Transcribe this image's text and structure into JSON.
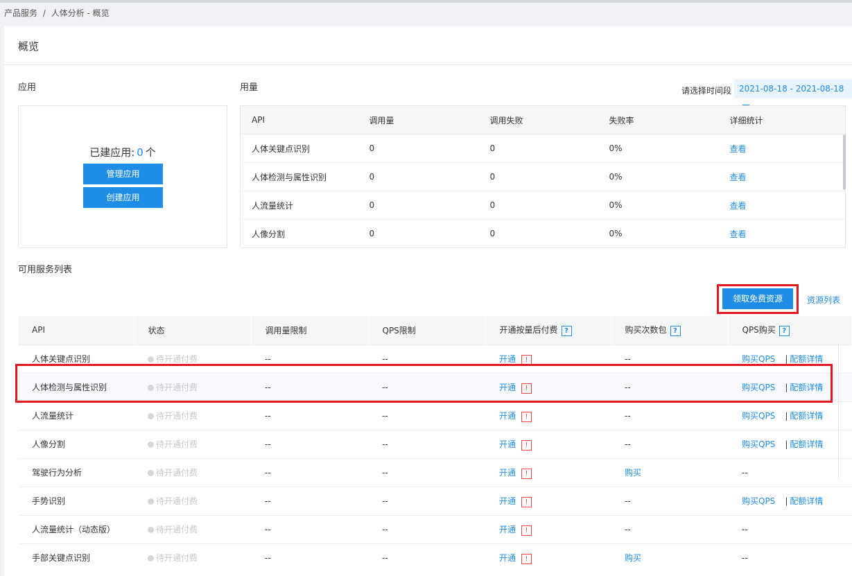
{
  "breadcrumb": {
    "root": "产品服务",
    "sep": "/",
    "current": "人体分析 - 概览"
  },
  "page_title": "概览",
  "app_section": {
    "label": "应用",
    "count_prefix": "已建应用:",
    "count": "0",
    "count_suffix": "个",
    "manage_button": "管理应用",
    "create_button": "创建应用"
  },
  "usage_section": {
    "label": "用量",
    "date_label": "请选择时间段",
    "date_range": "2021-08-18 - 2021-08-18",
    "columns": [
      "API",
      "调用量",
      "调用失败",
      "失败率",
      "详细统计"
    ],
    "rows": [
      {
        "api": "人体关键点识别",
        "calls": "0",
        "fails": "0",
        "rate": "0%",
        "detail": "查看"
      },
      {
        "api": "人体检测与属性识别",
        "calls": "0",
        "fails": "0",
        "rate": "0%",
        "detail": "查看"
      },
      {
        "api": "人流量统计",
        "calls": "0",
        "fails": "0",
        "rate": "0%",
        "detail": "查看"
      },
      {
        "api": "人像分割",
        "calls": "0",
        "fails": "0",
        "rate": "0%",
        "detail": "查看"
      }
    ]
  },
  "service_section": {
    "label": "可用服务列表",
    "free_button": "领取免费资源",
    "resource_link": "资源列表",
    "columns": [
      "API",
      "状态",
      "调用量限制",
      "QPS限制",
      "开通按量后付费",
      "购买次数包",
      "QPS购买"
    ],
    "help_glyph": "?",
    "warn_glyph": "!",
    "qps_sep": "|",
    "rows": [
      {
        "api": "人体关键点识别",
        "status": "待开通付费",
        "call_limit": "--",
        "qps_limit": "--",
        "open": "开通",
        "pack": "--",
        "qps_buy": "购买QPS",
        "quota": "配额详情"
      },
      {
        "api": "人体检测与属性识别",
        "status": "待开通付费",
        "call_limit": "--",
        "qps_limit": "--",
        "open": "开通",
        "pack": "--",
        "qps_buy": "购买QPS",
        "quota": "配额详情"
      },
      {
        "api": "人流量统计",
        "status": "待开通付费",
        "call_limit": "--",
        "qps_limit": "--",
        "open": "开通",
        "pack": "--",
        "qps_buy": "购买QPS",
        "quota": "配额详情"
      },
      {
        "api": "人像分割",
        "status": "待开通付费",
        "call_limit": "--",
        "qps_limit": "--",
        "open": "开通",
        "pack": "--",
        "qps_buy": "购买QPS",
        "quota": "配额详情"
      },
      {
        "api": "驾驶行为分析",
        "status": "待开通付费",
        "call_limit": "--",
        "qps_limit": "--",
        "open": "开通",
        "pack": "购买",
        "qps_buy": "--",
        "quota": ""
      },
      {
        "api": "手势识别",
        "status": "待开通付费",
        "call_limit": "--",
        "qps_limit": "--",
        "open": "开通",
        "pack": "--",
        "qps_buy": "购买QPS",
        "quota": "配额详情"
      },
      {
        "api": "人流量统计（动态版）",
        "status": "待开通付费",
        "call_limit": "--",
        "qps_limit": "--",
        "open": "开通",
        "pack": "--",
        "qps_buy": "--",
        "quota": ""
      },
      {
        "api": "手部关键点识别",
        "status": "待开通付费",
        "call_limit": "--",
        "qps_limit": "--",
        "open": "开通",
        "pack": "购买",
        "qps_buy": "--",
        "quota": ""
      }
    ]
  },
  "colors": {
    "accent": "#1f8ce6",
    "highlight_box": "#e0171f",
    "warn": "#e64545"
  },
  "icons": [
    "calendar-icon",
    "help-icon",
    "warn-icon",
    "status-dot-icon"
  ]
}
